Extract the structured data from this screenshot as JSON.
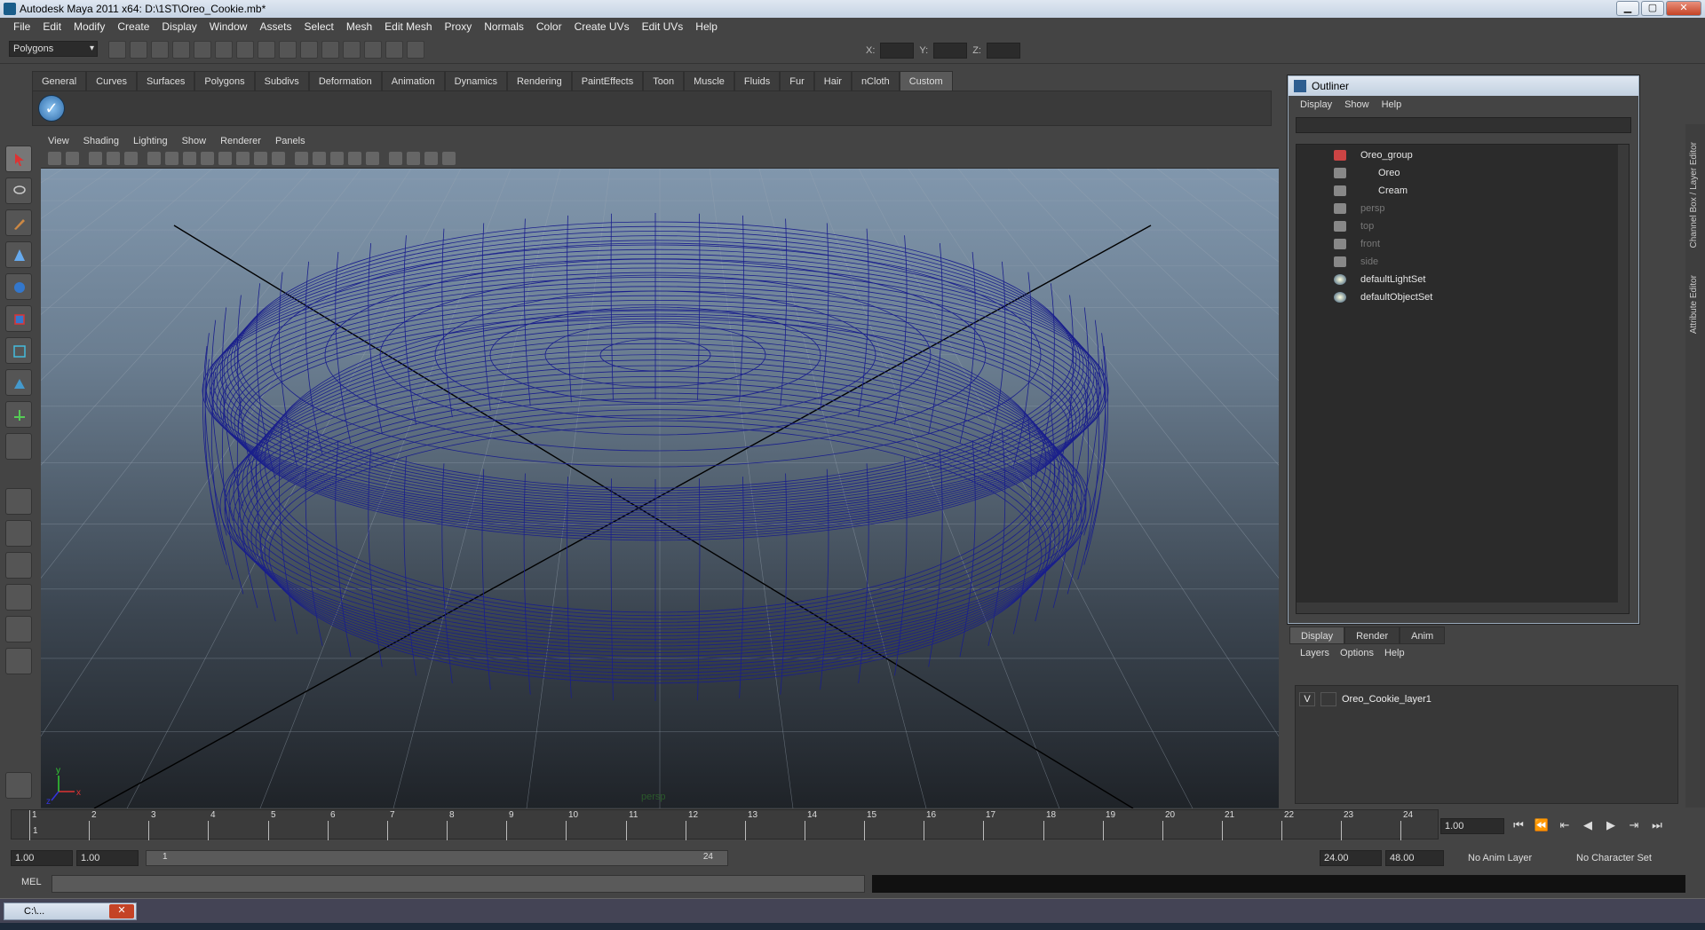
{
  "window": {
    "title": "Autodesk Maya 2011 x64: D:\\1ST\\Oreo_Cookie.mb*",
    "min": "▁",
    "max": "▢",
    "close": "✕"
  },
  "menubar": [
    "File",
    "Edit",
    "Modify",
    "Create",
    "Display",
    "Window",
    "Assets",
    "Select",
    "Mesh",
    "Edit Mesh",
    "Proxy",
    "Normals",
    "Color",
    "Create UVs",
    "Edit UVs",
    "Help"
  ],
  "toolbar": {
    "mode": "Polygons",
    "x_label": "X:",
    "y_label": "Y:",
    "z_label": "Z:"
  },
  "shelf_tabs": [
    "General",
    "Curves",
    "Surfaces",
    "Polygons",
    "Subdivs",
    "Deformation",
    "Animation",
    "Dynamics",
    "Rendering",
    "PaintEffects",
    "Toon",
    "Muscle",
    "Fluids",
    "Fur",
    "Hair",
    "nCloth",
    "Custom"
  ],
  "shelf_active": "Custom",
  "viewport": {
    "menu": [
      "View",
      "Shading",
      "Lighting",
      "Show",
      "Renderer",
      "Panels"
    ],
    "camera_label": "persp",
    "axis_x": "x",
    "axis_y": "y",
    "axis_z": "z",
    "wire_color": "#1a1f8c"
  },
  "outliner": {
    "title": "Outliner",
    "menu": [
      "Display",
      "Show",
      "Help"
    ],
    "items": [
      {
        "label": "Oreo_group",
        "dim": false,
        "indent": 0
      },
      {
        "label": "Oreo",
        "dim": false,
        "indent": 1
      },
      {
        "label": "Cream",
        "dim": false,
        "indent": 1
      },
      {
        "label": "persp",
        "dim": true,
        "indent": 0
      },
      {
        "label": "top",
        "dim": true,
        "indent": 0
      },
      {
        "label": "front",
        "dim": true,
        "indent": 0
      },
      {
        "label": "side",
        "dim": true,
        "indent": 0
      },
      {
        "label": "defaultLightSet",
        "dim": false,
        "indent": 0
      },
      {
        "label": "defaultObjectSet",
        "dim": false,
        "indent": 0
      }
    ]
  },
  "channel": {
    "tabs": [
      "Display",
      "Render",
      "Anim"
    ],
    "menu": [
      "Layers",
      "Options",
      "Help"
    ],
    "layer": {
      "visible": "V",
      "name": "Oreo_Cookie_layer1"
    },
    "strip_labels": [
      "Channel Box / Layer Editor",
      "Attribute Editor"
    ]
  },
  "timeline": {
    "ticks": [
      "1",
      "2",
      "3",
      "4",
      "5",
      "6",
      "7",
      "8",
      "9",
      "10",
      "11",
      "12",
      "13",
      "14",
      "15",
      "16",
      "17",
      "18",
      "19",
      "20",
      "21",
      "22",
      "23",
      "24"
    ],
    "current_marker": "1",
    "current_frame": "1.00"
  },
  "range": {
    "start": "1.00",
    "start2": "1.00",
    "slider_start": "1",
    "slider_end": "24",
    "end": "24.00",
    "end2": "48.00",
    "anim_layer": "No Anim Layer",
    "char_set": "No Character Set"
  },
  "mel": {
    "label": "MEL"
  },
  "taskbar": {
    "item": "C:\\..."
  }
}
